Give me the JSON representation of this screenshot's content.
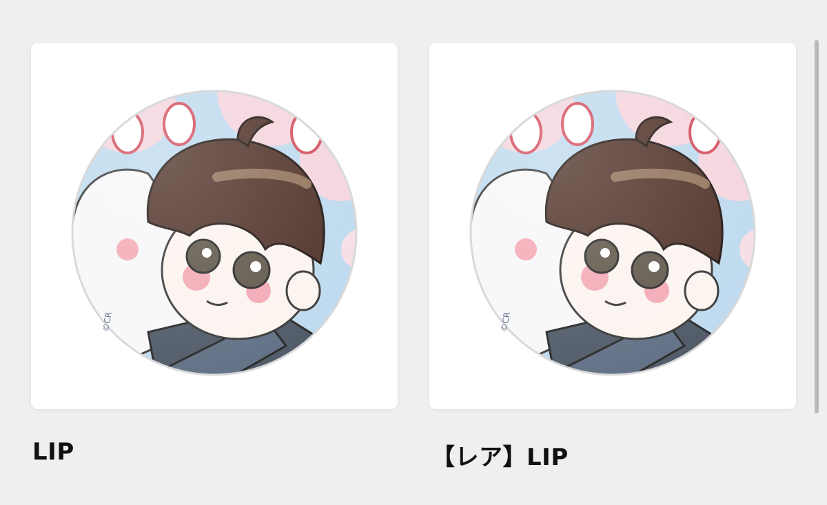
{
  "products": [
    {
      "title": "LIP",
      "image_label": "©CR"
    },
    {
      "title": "【レア】LIP",
      "image_label": "©CR"
    }
  ],
  "colors": {
    "background": "#efefef",
    "card": "#ffffff",
    "hair": "#4a2c22",
    "sky": "#bcd9ee",
    "blossom": "#f4c9d4"
  }
}
